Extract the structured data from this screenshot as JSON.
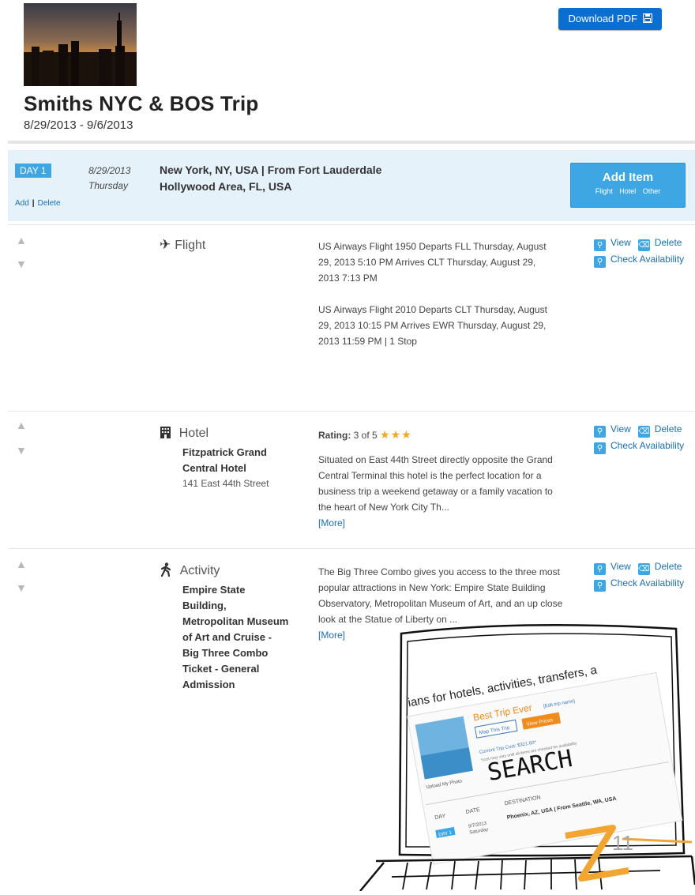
{
  "toolbar": {
    "download_label": "Download PDF",
    "download_icon": "save-icon"
  },
  "trip": {
    "title": "Smiths NYC & BOS Trip",
    "dates": "8/29/2013 - 9/6/2013"
  },
  "day": {
    "tag": "DAY 1",
    "date": "8/29/2013",
    "weekday": "Thursday",
    "location": "New York, NY, USA | From Fort Lauderdale Hollywood Area, FL, USA",
    "add_label": "Add",
    "delete_label": "Delete",
    "add_item": {
      "title": "Add Item",
      "options": [
        "Flight",
        "Hotel",
        "Other"
      ]
    }
  },
  "actions": {
    "view": "View",
    "delete": "Delete",
    "check": "Check Availability"
  },
  "items": [
    {
      "kind": "Flight",
      "icon": "airplane-icon",
      "desc1": "US Airways Flight 1950 Departs FLL Thursday, August 29, 2013 5:10 PM Arrives CLT Thursday, August 29, 2013 7:13 PM",
      "desc2": "US Airways Flight 2010 Departs CLT Thursday, August 29, 2013 10:15 PM Arrives EWR Thursday, August 29, 2013 11:59 PM | 1 Stop"
    },
    {
      "kind": "Hotel",
      "icon": "building-icon",
      "name": "Fitzpatrick Grand Central Hotel",
      "address": "141 East 44th Street",
      "rating_label": "Rating:",
      "rating_value": "3 of 5",
      "rating": 3,
      "desc": "Situated on East 44th Street directly opposite the Grand Central Terminal this hotel is the perfect location for a business trip a weekend getaway or a family vacation to the heart of New York City Th...",
      "more": "[More]"
    },
    {
      "kind": "Activity",
      "icon": "walking-person-icon",
      "name": "Empire State Building, Metropolitan Museum of Art and Cruise - Big Three Combo Ticket - General Admission",
      "desc": "The Big Three Combo gives you access to the three most popular attractions in New York: Empire State Building Observatory, Metropolitan Museum of Art, and an up close look at the Statue of Liberty on ...",
      "more": "[More]"
    }
  ],
  "sketch": {
    "banner": "ians for hotels, activities, transfers, a",
    "trip_name": "Best Trip Ever",
    "edit_label": "[Edit trip name]",
    "map_button": "Map This Trip",
    "prices_button": "View Prices",
    "cost": "Current Trip Cost: $321.60*",
    "note": "*cost may vary until all items are checked for availability",
    "upload": "Upload My Photo",
    "search_word": "SEARCH",
    "col_day": "DAY",
    "col_date": "DATE",
    "col_destination": "DESTINATION",
    "row_day": "DAY 1",
    "row_date": "9/7/2013",
    "row_weekday": "Saturday",
    "row_dest": "Phoenix, AZ, USA | From Seattle, WA, USA"
  },
  "page_number": "11"
}
